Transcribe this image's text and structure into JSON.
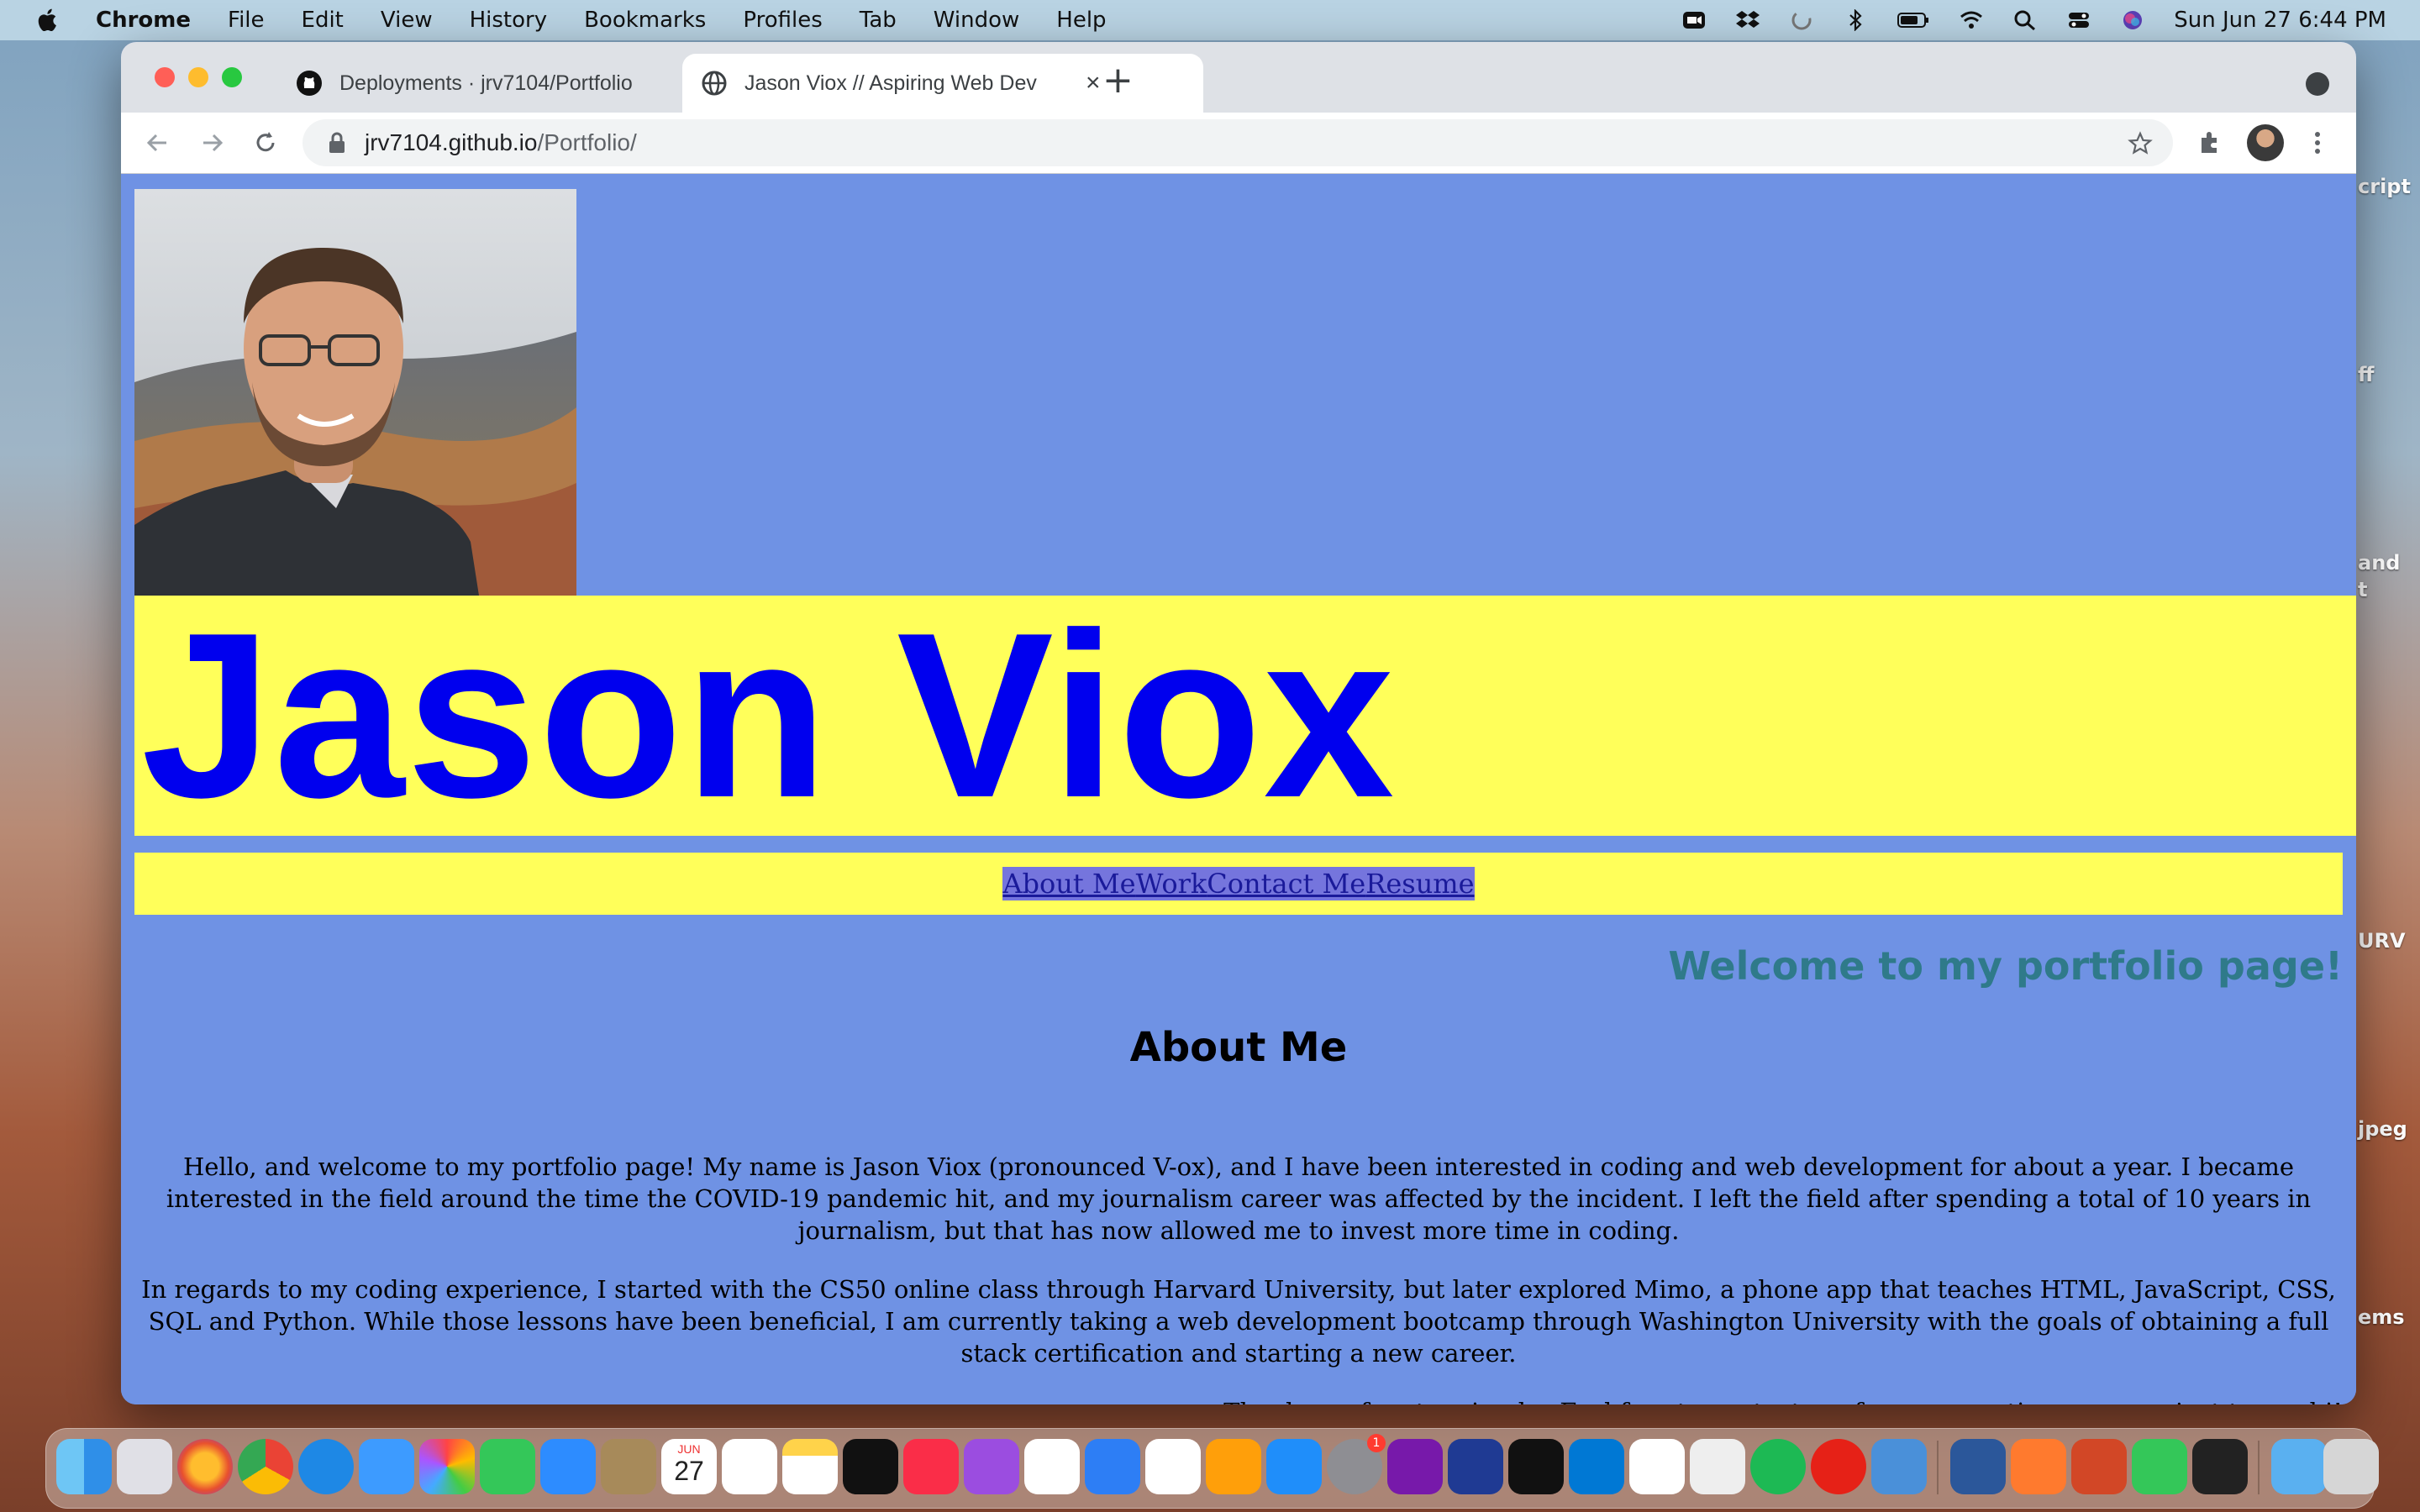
{
  "menubar": {
    "app_name": "Chrome",
    "items": [
      "File",
      "Edit",
      "View",
      "History",
      "Bookmarks",
      "Profiles",
      "Tab",
      "Window",
      "Help"
    ],
    "clock": "Sun Jun 27  6:44 PM",
    "status_icons": [
      "zoom-icon",
      "dropbox-icon",
      "sync-icon",
      "bluetooth-icon",
      "battery-icon",
      "wifi-icon",
      "spotlight-search-icon",
      "control-center-icon",
      "siri-icon"
    ]
  },
  "desktop": {
    "side_labels": [
      "cript",
      "ff",
      "and",
      "t",
      "URV",
      "jpeg",
      "ems"
    ]
  },
  "browser": {
    "tabs": [
      {
        "title": "Deployments · jrv7104/Portfolio",
        "icon": "github-icon",
        "active": false
      },
      {
        "title": "Jason Viox // Aspiring Web Dev",
        "icon": "globe-icon",
        "active": true
      }
    ],
    "url_host": "jrv7104.github.io",
    "url_path": "/Portfolio/"
  },
  "page": {
    "name": "Jason Viox",
    "photo_alt": "Portrait photo",
    "nav_links": [
      "About Me",
      "Work",
      "Contact Me",
      "Resume"
    ],
    "welcome": "Welcome to my portfolio page!",
    "about_heading": "About Me",
    "paragraphs": [
      "Hello, and welcome to my portfolio page! My name is Jason Viox (pronounced V-ox), and I have been interested in coding and web development for about a year. I became interested in the field around the time the COVID-19 pandemic hit, and my journalism career was affected by the incident. I left the field after spending a total of 10 years in journalism, but that has now allowed me to invest more time in coding.",
      "In regards to my coding experience, I started with the CS50 online class through Harvard University, but later explored Mimo, a phone app that teaches HTML, JavaScript, CSS, SQL and Python. While those lessons have been beneficial, I am currently taking a web development bootcamp through Washington University with the goals of obtaining a full stack certification and starting a new career.",
      "Thank you for stopping by. Feel free to contact me for any questions or even just to say hi!"
    ]
  },
  "dock": {
    "calendar_month": "JUN",
    "calendar_day": "27",
    "apps": [
      "finder-icon",
      "launchpad-icon",
      "firefox-icon",
      "chrome-icon",
      "safari-icon",
      "mail-icon",
      "photos-icon",
      "facetime-icon",
      "zoom-icon",
      "contacts-icon",
      "calendar-icon",
      "reminders-icon",
      "notes-icon",
      "apple-tv-icon",
      "music-icon",
      "podcasts-icon",
      "news-icon",
      "keynote-icon",
      "numbers-icon",
      "pages-icon",
      "app-store-icon",
      "system-preferences-icon",
      "onenote-icon",
      "dropbox-icon",
      "terminal-icon",
      "vscode-icon",
      "slack-icon",
      "textedit-icon",
      "spotify-icon",
      "youtube-icon",
      "network-icon",
      "word-icon",
      "pen-icon",
      "powerpoint-icon",
      "messages-icon",
      "activity-monitor-icon",
      "downloads-icon",
      "trash-icon"
    ],
    "notification_badge": "1"
  },
  "colors": {
    "page_background": "#6f92e4",
    "banner_yellow": "#ffff5a",
    "name_blue": "#0000ee",
    "welcome_teal": "#2f7a8a"
  }
}
